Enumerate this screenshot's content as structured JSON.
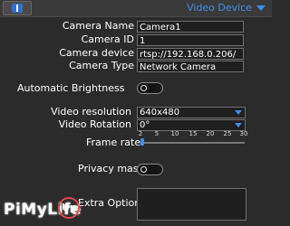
{
  "header": {
    "title": "Video Device"
  },
  "fields": {
    "camera_name_label": "Camera Name",
    "camera_name_value": "Camera1",
    "camera_id_label": "Camera ID",
    "camera_id_value": "1",
    "camera_device_label": "Camera device",
    "camera_device_value": "rtsp://192.168.0.206/",
    "camera_type_label": "Camera Type",
    "camera_type_value": "Network Camera"
  },
  "auto_brightness": {
    "label": "Automatic Brightness",
    "on": false
  },
  "video": {
    "resolution_label": "Video resolution",
    "resolution_value": "640x480",
    "rotation_label": "Video Rotation",
    "rotation_value": "0°",
    "frame_rate_label": "Frame rate",
    "frame_rate_ticks": [
      "2",
      "5",
      "10",
      "15",
      "20",
      "25",
      "30"
    ],
    "frame_rate_value": 2,
    "frame_rate_range": [
      2,
      30
    ]
  },
  "privacy_mask": {
    "label": "Privacy mask",
    "on": false
  },
  "extra": {
    "label": "Extra Options",
    "value": ""
  },
  "watermark": {
    "text": "PiMyLife",
    "badge": "Up"
  },
  "colors": {
    "accent": "#3f8fe6",
    "background": "#2b2b2b",
    "field_bg": "#1f1f1f"
  }
}
